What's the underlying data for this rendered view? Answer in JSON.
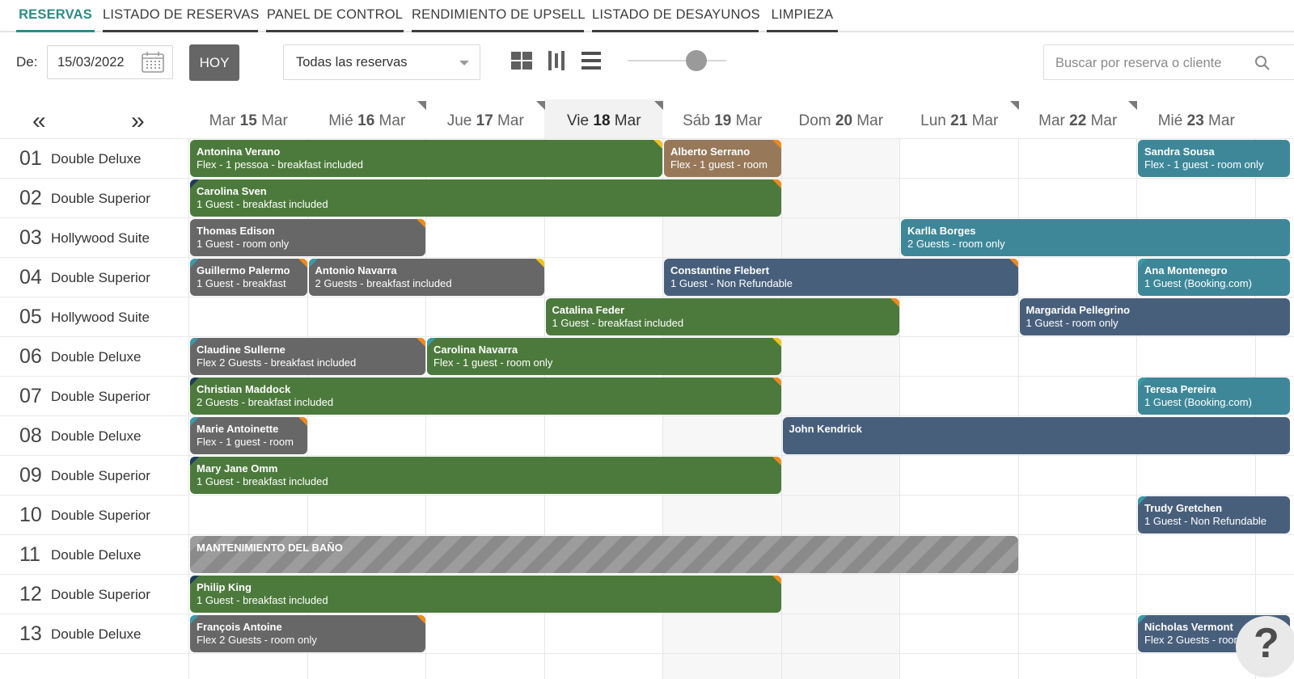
{
  "tabs": [
    {
      "label": "RESERVAS",
      "active": true
    },
    {
      "label": "LISTADO DE RESERVAS",
      "active": false
    },
    {
      "label": "PANEL DE CONTROL",
      "active": false
    },
    {
      "label": "RENDIMIENTO DE UPSELL",
      "active": false
    },
    {
      "label": "LISTADO DE DESAYUNOS",
      "active": false
    },
    {
      "label": "LIMPIEZA",
      "active": false
    }
  ],
  "toolbar": {
    "from_label": "De:",
    "date_value": "15/03/2022",
    "today_button": "HOY",
    "filter_selected": "Todas las reservas",
    "view_icons": [
      "grid-view-icon",
      "column-view-icon",
      "list-view-icon"
    ],
    "zoom_level": 0.8,
    "search_placeholder": "Buscar por reserva o cliente"
  },
  "nav": {
    "prev": "«",
    "next": "»"
  },
  "days": [
    {
      "dow": "Mar",
      "day": "15",
      "mon": "Mar",
      "today": false,
      "flag": false
    },
    {
      "dow": "Mié",
      "day": "16",
      "mon": "Mar",
      "today": false,
      "flag": true
    },
    {
      "dow": "Jue",
      "day": "17",
      "mon": "Mar",
      "today": false,
      "flag": true
    },
    {
      "dow": "Vie",
      "day": "18",
      "mon": "Mar",
      "today": true,
      "flag": true
    },
    {
      "dow": "Sáb",
      "day": "19",
      "mon": "Mar",
      "today": false,
      "flag": false
    },
    {
      "dow": "Dom",
      "day": "20",
      "mon": "Mar",
      "today": false,
      "flag": false
    },
    {
      "dow": "Lun",
      "day": "21",
      "mon": "Mar",
      "today": false,
      "flag": true
    },
    {
      "dow": "Mar",
      "day": "22",
      "mon": "Mar",
      "today": false,
      "flag": true
    },
    {
      "dow": "Mié",
      "day": "23",
      "mon": "Mar",
      "today": false,
      "flag": false
    }
  ],
  "rooms": [
    {
      "num": "01",
      "name": "Double Deluxe"
    },
    {
      "num": "02",
      "name": "Double Superior"
    },
    {
      "num": "03",
      "name": "Hollywood Suite"
    },
    {
      "num": "04",
      "name": "Double Superior"
    },
    {
      "num": "05",
      "name": "Hollywood Suite"
    },
    {
      "num": "06",
      "name": "Double Deluxe"
    },
    {
      "num": "07",
      "name": "Double Superior"
    },
    {
      "num": "08",
      "name": "Double Deluxe"
    },
    {
      "num": "09",
      "name": "Double Superior"
    },
    {
      "num": "10",
      "name": "Double Superior"
    },
    {
      "num": "11",
      "name": "Double Deluxe"
    },
    {
      "num": "12",
      "name": "Double Superior"
    },
    {
      "num": "13",
      "name": "Double Deluxe"
    }
  ],
  "bookings": [
    {
      "row": 0,
      "start": 0,
      "end": 4,
      "color": "green",
      "guest": "Antonina Verano",
      "detail": "Flex - 1 pessoa - breakfast included",
      "left_mark": "",
      "right_mark": "yellow"
    },
    {
      "row": 0,
      "start": 4,
      "end": 5,
      "color": "brown",
      "guest": "Alberto Serrano",
      "detail": "Flex - 1 guest - room",
      "left_mark": "",
      "right_mark": "orange"
    },
    {
      "row": 0,
      "start": 8,
      "end": 9.3,
      "color": "teal",
      "guest": "Sandra Sousa",
      "detail": "Flex - 1 guest - room only",
      "left_mark": "",
      "right_mark": ""
    },
    {
      "row": 1,
      "start": 0,
      "end": 5,
      "color": "green",
      "guest": "Carolina Sven",
      "detail": "1 Guest - breakfast included",
      "left_mark": "navy",
      "right_mark": "orange"
    },
    {
      "row": 2,
      "start": 0,
      "end": 2,
      "color": "gray",
      "guest": "Thomas Edison",
      "detail": "1 Guest - room only",
      "left_mark": "",
      "right_mark": "orange"
    },
    {
      "row": 2,
      "start": 6,
      "end": 9.3,
      "color": "teal",
      "guest": "Karlla Borges",
      "detail": "2 Guests - room only",
      "left_mark": "",
      "right_mark": ""
    },
    {
      "row": 3,
      "start": 0,
      "end": 1,
      "color": "gray",
      "guest": "Guillermo Palermo",
      "detail": "1 Guest - breakfast",
      "left_mark": "teal",
      "right_mark": "orange"
    },
    {
      "row": 3,
      "start": 1,
      "end": 3,
      "color": "gray",
      "guest": "Antonio Navarra",
      "detail": "2 Guests - breakfast included",
      "left_mark": "teal",
      "right_mark": "yellow"
    },
    {
      "row": 3,
      "start": 4,
      "end": 7,
      "color": "blue",
      "guest": "Constantine Flebert",
      "detail": "1 Guest - Non Refundable",
      "left_mark": "",
      "right_mark": "orange"
    },
    {
      "row": 3,
      "start": 8,
      "end": 9.3,
      "color": "teal",
      "guest": "Ana Montenegro",
      "detail": "1 Guest (Booking.com)",
      "left_mark": "teal",
      "right_mark": ""
    },
    {
      "row": 4,
      "start": 3,
      "end": 6,
      "color": "green",
      "guest": "Catalina Feder",
      "detail": "1 Guest - breakfast included",
      "left_mark": "",
      "right_mark": "orange"
    },
    {
      "row": 4,
      "start": 7,
      "end": 9.3,
      "color": "blue",
      "guest": "Margarida Pellegrino",
      "detail": "1 Guest - room only",
      "left_mark": "",
      "right_mark": ""
    },
    {
      "row": 5,
      "start": 0,
      "end": 2,
      "color": "gray",
      "guest": "Claudine Sullerne",
      "detail": "Flex 2 Guests - breakfast included",
      "left_mark": "teal",
      "right_mark": "orange"
    },
    {
      "row": 5,
      "start": 2,
      "end": 5,
      "color": "green",
      "guest": "Carolina Navarra",
      "detail": "Flex - 1 guest - room only",
      "left_mark": "teal",
      "right_mark": "yellow"
    },
    {
      "row": 6,
      "start": 0,
      "end": 5,
      "color": "green",
      "guest": "Christian Maddock",
      "detail": "2 Guests - breakfast included",
      "left_mark": "navy",
      "right_mark": "orange"
    },
    {
      "row": 6,
      "start": 8,
      "end": 9.3,
      "color": "teal",
      "guest": "Teresa Pereira",
      "detail": "1 Guest (Booking.com)",
      "left_mark": "teal",
      "right_mark": ""
    },
    {
      "row": 7,
      "start": 0,
      "end": 1,
      "color": "gray",
      "guest": "Marie Antoinette",
      "detail": "Flex - 1 guest - room",
      "left_mark": "teal",
      "right_mark": "orange"
    },
    {
      "row": 7,
      "start": 5,
      "end": 9.3,
      "color": "blue",
      "guest": "John Kendrick",
      "detail": "",
      "left_mark": "",
      "right_mark": ""
    },
    {
      "row": 8,
      "start": 0,
      "end": 5,
      "color": "green",
      "guest": "Mary Jane Omm",
      "detail": "1 Guest - breakfast included",
      "left_mark": "navy",
      "right_mark": "orange"
    },
    {
      "row": 9,
      "start": 8,
      "end": 9.3,
      "color": "blue",
      "guest": "Trudy Gretchen",
      "detail": "1 Guest - Non Refundable",
      "left_mark": "teal",
      "right_mark": ""
    },
    {
      "row": 10,
      "start": 0,
      "end": 7,
      "color": "maint",
      "guest": "MANTENIMIENTO DEL BAÑO",
      "detail": "",
      "left_mark": "",
      "right_mark": ""
    },
    {
      "row": 11,
      "start": 0,
      "end": 5,
      "color": "green",
      "guest": "Philip King",
      "detail": "1 Guest - breakfast included",
      "left_mark": "navy",
      "right_mark": "orange"
    },
    {
      "row": 12,
      "start": 0,
      "end": 2,
      "color": "gray",
      "guest": "François Antoine",
      "detail": "Flex 2 Guests - room only",
      "left_mark": "teal",
      "right_mark": "orange"
    },
    {
      "row": 12,
      "start": 8,
      "end": 9.3,
      "color": "blue",
      "guest": "Nicholas Vermont",
      "detail": "Flex 2 Guests - room only",
      "left_mark": "teal",
      "right_mark": ""
    }
  ],
  "help": "?",
  "colors": {
    "accent": "#2e8b85",
    "green": "#4c7a3c",
    "gray": "#676767",
    "teal": "#3d8799",
    "blue": "#485f7c",
    "brown": "#97795a",
    "flag_orange": "#f08a1c",
    "flag_yellow": "#f2c21b"
  }
}
